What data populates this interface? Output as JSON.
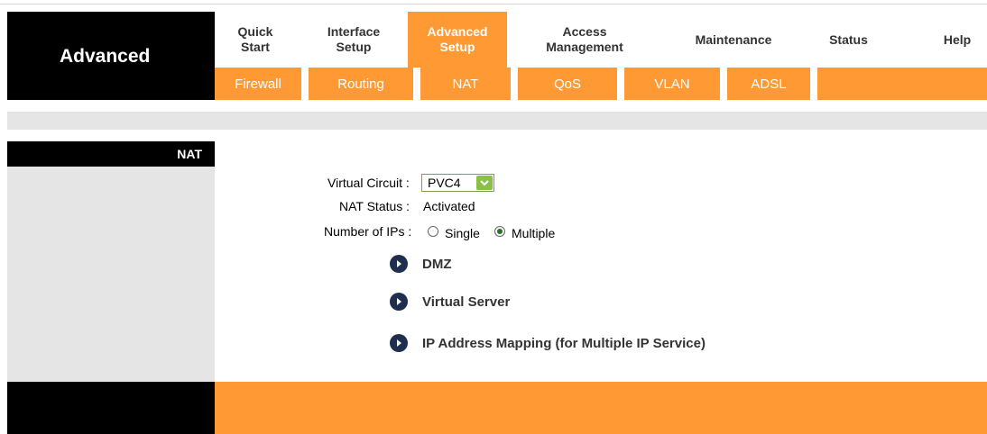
{
  "brand": {
    "title": "Advanced"
  },
  "main_nav": [
    {
      "label": "Quick\nStart",
      "active": false
    },
    {
      "label": "Interface\nSetup",
      "active": false
    },
    {
      "label": "Advanced\nSetup",
      "active": true
    },
    {
      "label": "Access\nManagement",
      "active": false
    },
    {
      "label": "Maintenance",
      "active": false
    },
    {
      "label": "Status",
      "active": false
    },
    {
      "label": "Help",
      "active": false
    }
  ],
  "sub_nav": [
    "Firewall",
    "Routing",
    "NAT",
    "QoS",
    "VLAN",
    "ADSL"
  ],
  "section": {
    "title": "NAT"
  },
  "form": {
    "virtual_circuit_label": "Virtual Circuit :",
    "virtual_circuit_value": "PVC4",
    "nat_status_label": "NAT Status :",
    "nat_status_value": "Activated",
    "number_of_ips_label": "Number of IPs :",
    "option_single": "Single",
    "option_multiple": "Multiple",
    "selected_option": "Multiple"
  },
  "links": [
    {
      "label": "DMZ"
    },
    {
      "label": "Virtual Server"
    },
    {
      "label": "IP Address Mapping (for Multiple IP Service)"
    }
  ],
  "colors": {
    "accent": "#ff9933",
    "brand_bg": "#000000",
    "panel_bg": "#e5e5e5",
    "link_icon": "#1e2e4f"
  }
}
